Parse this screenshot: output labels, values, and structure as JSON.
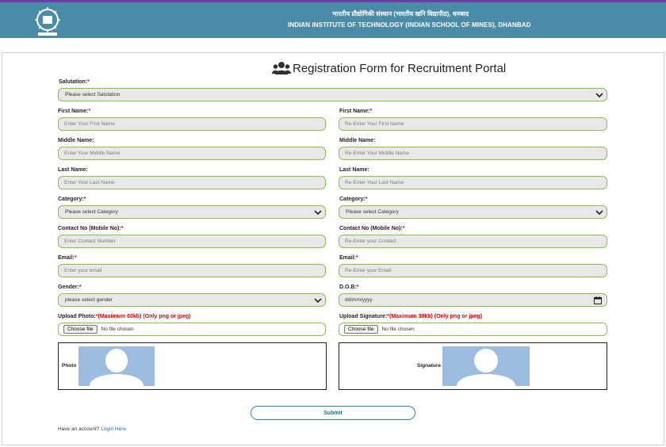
{
  "header": {
    "hindi_title": "भारतीय प्रौद्योगिकी संस्थान (भारतीय खनि विद्यापीठ), धनबाद",
    "english_title": "INDIAN INSTITUTE OF TECHNOLOGY (INDIAN SCHOOL OF MINES), DHANBAD",
    "logo_icon": "iit-ism-logo",
    "bar_color": "#4a8ba8"
  },
  "form": {
    "title": "Registration Form for Recruitment Portal",
    "title_icon": "users-icon",
    "salutation": {
      "label": "Salutation:",
      "required": "*",
      "placeholder": "Please select Salutation"
    },
    "first_name": {
      "label": "First Name:",
      "required": "*",
      "placeholder": "Enter Your First Name",
      "confirm_label": "First Name:",
      "confirm_placeholder": "Re-Enter Your First Name"
    },
    "middle_name": {
      "label": "Middle Name:",
      "placeholder": "Enter Your Middle Name",
      "confirm_label": "Middle Name:",
      "confirm_placeholder": "Re-Enter Your Middle Name"
    },
    "last_name": {
      "label": "Last Name:",
      "placeholder": "Enter Your Last Name",
      "confirm_label": "Last Name:",
      "confirm_placeholder": "Re-Enter Your Last Name"
    },
    "category": {
      "label": "Category:",
      "required": "*",
      "placeholder": "Please select Category",
      "confirm_label": "Category:",
      "confirm_placeholder": "Please select Category"
    },
    "contact": {
      "label": "Contact No (Mobile No):",
      "required": "*",
      "placeholder": "Enter Contact Number",
      "confirm_label": "Contact No (Mobile No):",
      "confirm_placeholder": "Re-Enter your Contact"
    },
    "email": {
      "label": "Email:",
      "required": "*",
      "placeholder": "Enter your email",
      "confirm_label": "Email:",
      "confirm_placeholder": "Re-Enter your Email"
    },
    "gender": {
      "label": "Gender:",
      "required": "*",
      "placeholder": "please select gender"
    },
    "dob": {
      "label": "D.O.B:",
      "required": "*",
      "placeholder": "dd/mm/yyyy"
    },
    "photo": {
      "label": "Upload Photo:",
      "required": "*",
      "note": "(Maximum 60kb) (Only png or jpeg)",
      "button": "Choose file",
      "status": "No file chosen",
      "preview_label": "Photo"
    },
    "signature": {
      "label": "Upload Signature:",
      "required": "*",
      "note": "(Maximum 30kb) (Only png or jpeg)",
      "button": "Choose file",
      "status": "No file chosen",
      "preview_label": "Signature"
    },
    "submit_label": "Submit",
    "account_prompt": "Have an account?",
    "login_link": "Login Here"
  },
  "colors": {
    "field_border": "#8ac04a",
    "field_bg": "#e8e8e8",
    "required": "#e00000",
    "link": "#1a6fb5",
    "submit_border": "#2e8b8b"
  }
}
